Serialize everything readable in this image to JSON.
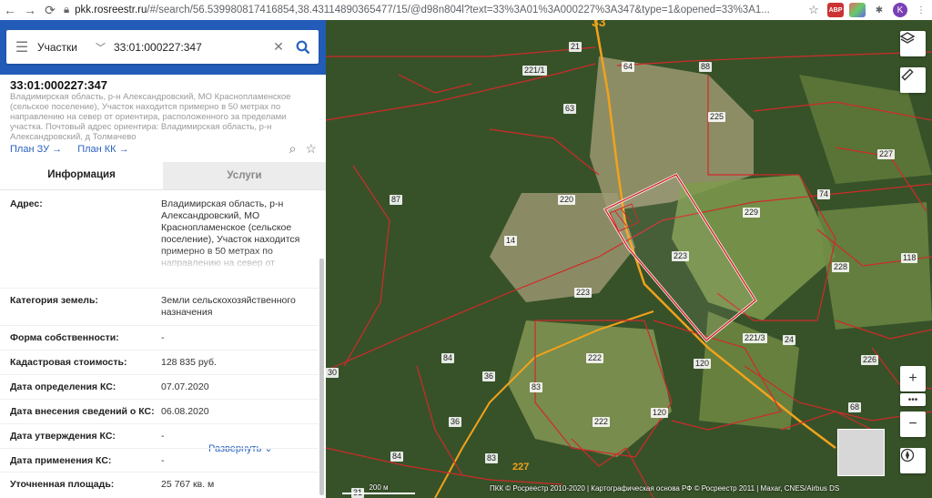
{
  "browser": {
    "url_host": "pkk.rosreestr.ru",
    "url_path": "/#/search/56.539980817416854,38.43114890365477/15/@d98n804l?text=33%3A01%3A000227%3A347&type=1&opened=33%3A1...",
    "ext_abp": "ABP",
    "profile_initial": "K"
  },
  "search": {
    "type_label": "Участки",
    "value": "33:01:000227:347"
  },
  "parcel": {
    "cad_number": "33:01:000227:347",
    "description": "Владимирская область, р-н Александровский, МО Краснопламенское (сельское поселение), Участок находится примерно в 50 метрах по направлению на север от ориентира, расположенного за пределами участка. Почтовый адрес ориентира: Владимирская область, р-н Александровский, д Толмачево",
    "link_plan_zu": "План ЗУ →",
    "link_plan_kk": "План КК →"
  },
  "tabs": {
    "info": "Информация",
    "services": "Услуги"
  },
  "info": {
    "address_label": "Адрес:",
    "address_value": "Владимирская область, р-н Александровский, МО Краснопламенское (сельское поселение), Участок находится примерно в 50 метрах по направлению на север от",
    "expand_label": "Развернуть",
    "rows": [
      {
        "label": "Категория земель:",
        "value": "Земли сельскохозяйственного назначения"
      },
      {
        "label": "Форма собственности:",
        "value": "-"
      },
      {
        "label": "Кадастровая стоимость:",
        "value": "128 835 руб."
      },
      {
        "label": "Дата определения КС:",
        "value": "07.07.2020"
      },
      {
        "label": "Дата внесения сведений о КС:",
        "value": "06.08.2020"
      },
      {
        "label": "Дата утверждения КС:",
        "value": "-"
      },
      {
        "label": "Дата применения КС:",
        "value": "-"
      },
      {
        "label": "Уточненная площадь:",
        "value": "25 767 кв. м"
      }
    ]
  },
  "map": {
    "parcel_labels": [
      "33",
      "21",
      "221/1",
      "64",
      "88",
      "63",
      "225",
      "227",
      "220",
      "74",
      "229",
      "87",
      "14",
      "223",
      "228",
      "118",
      "223",
      "84",
      "221/3",
      "24",
      "30",
      "36",
      "222",
      "120",
      "226",
      "83",
      "68",
      "36",
      "120",
      "222",
      "84",
      "83",
      "227",
      "31"
    ],
    "attribution": "ПКК © Росреестр 2010-2020 | Картографическая основа РФ © Росреестр 2011 | Maxar, CNES/Airbus DS",
    "scale_label": "200 м"
  },
  "colors": {
    "brand_blue": "#225cb8",
    "link": "#2a63c0",
    "parcel_line": "#d02a2a",
    "road": "#f2a21b"
  }
}
